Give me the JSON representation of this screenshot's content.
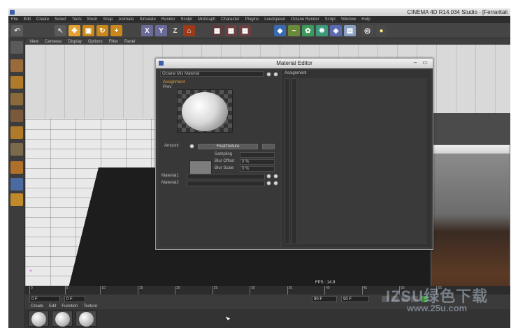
{
  "window": {
    "title": "CINEMA 4D R14.034 Studio - [Ferraritali"
  },
  "menubar": [
    "File",
    "Edit",
    "Create",
    "Select",
    "Tools",
    "Mesh",
    "Snap",
    "Animate",
    "Simulate",
    "Render",
    "Sculpt",
    "MoGraph",
    "Character",
    "Plugins",
    "Loudspeed",
    "Octane Render",
    "Script",
    "Window",
    "Help"
  ],
  "viewport": {
    "menu": [
      "View",
      "Cameras",
      "Display",
      "Options",
      "Filter",
      "Panel"
    ],
    "fps": "FPS : 14.9"
  },
  "timeline": {
    "ticks": [
      "0",
      "5",
      "10",
      "15",
      "20",
      "25",
      "30",
      "35",
      "40",
      "45",
      "50",
      "55"
    ],
    "frame_start": "0 F",
    "frame_current": "0 F",
    "frame_end": "90 F",
    "frame_end2": "90 F"
  },
  "material_manager": {
    "menu": [
      "Create",
      "Edit",
      "Function",
      "Texture"
    ]
  },
  "material_editor": {
    "title": "Material Editor",
    "material_name": "Octane Mix Material",
    "left_section": "Assignment",
    "preview_label": "Prev",
    "amount_label": "Amount",
    "amount_button": "FloatTexture",
    "sampling_label": "Sampling",
    "blur_offset_label": "Blur Offset",
    "blur_offset_value": "0 %",
    "blur_scale_label": "Blur Scale",
    "blur_scale_value": "0 %",
    "material1_label": "Material1",
    "material2_label": "Material2",
    "right_section": "Assignment"
  },
  "watermark": {
    "line1": "IZSU绿色下载",
    "line2": "www.25u.com"
  }
}
